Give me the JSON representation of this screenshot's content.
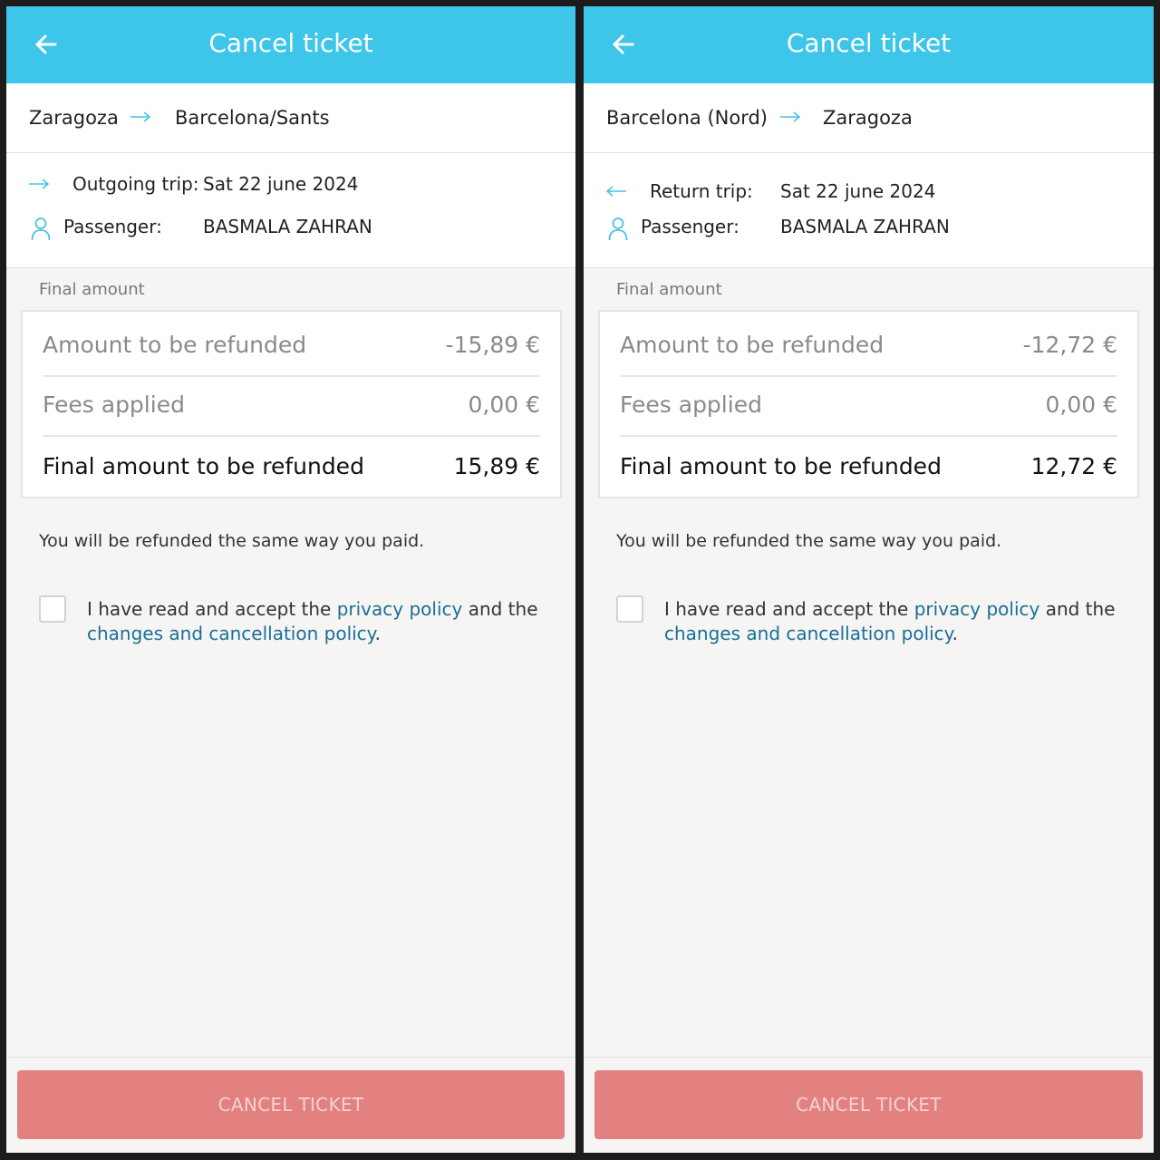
{
  "screens": [
    {
      "header": {
        "title": "Cancel ticket"
      },
      "route": {
        "from": "Zaragoza",
        "to": "Barcelona/Sants"
      },
      "trip": {
        "label": "Outgoing trip:",
        "date": "Sat 22 june 2024",
        "direction": "outgoing"
      },
      "passenger": {
        "label": "Passenger:",
        "name": "BASMALA ZAHRAN"
      },
      "section_label": "Final amount",
      "amounts": {
        "refund_label": "Amount to be refunded",
        "refund_value": "-15,89 €",
        "fees_label": "Fees applied",
        "fees_value": "0,00 €",
        "final_label": "Final amount to be refunded",
        "final_value": "15,89 €"
      },
      "refund_note": "You will be refunded the same way you paid.",
      "consent": {
        "pre": "I have read and accept the ",
        "privacy_link": "privacy policy",
        "mid": " and the",
        "cancellation_link": "changes and cancellation policy",
        "end": "."
      },
      "button": {
        "label": "CANCEL TICKET"
      }
    },
    {
      "header": {
        "title": "Cancel ticket"
      },
      "route": {
        "from": "Barcelona (Nord)",
        "to": "Zaragoza"
      },
      "trip": {
        "label": "Return trip:",
        "date": "Sat 22 june 2024",
        "direction": "return"
      },
      "passenger": {
        "label": "Passenger:",
        "name": "BASMALA ZAHRAN"
      },
      "section_label": "Final amount",
      "amounts": {
        "refund_label": "Amount to be refunded",
        "refund_value": "-12,72 €",
        "fees_label": "Fees applied",
        "fees_value": "0,00 €",
        "final_label": "Final amount to be refunded",
        "final_value": "12,72 €"
      },
      "refund_note": "You will be refunded the same way you paid.",
      "consent": {
        "pre": "I have read and accept the ",
        "privacy_link": "privacy policy",
        "mid": " and the",
        "cancellation_link": "changes and cancellation policy",
        "end": "."
      },
      "button": {
        "label": "CANCEL TICKET"
      }
    }
  ],
  "colors": {
    "header": "#3ec6ea",
    "accent_icon": "#48c3e6",
    "link": "#1a6f96",
    "button": "#e38181"
  }
}
